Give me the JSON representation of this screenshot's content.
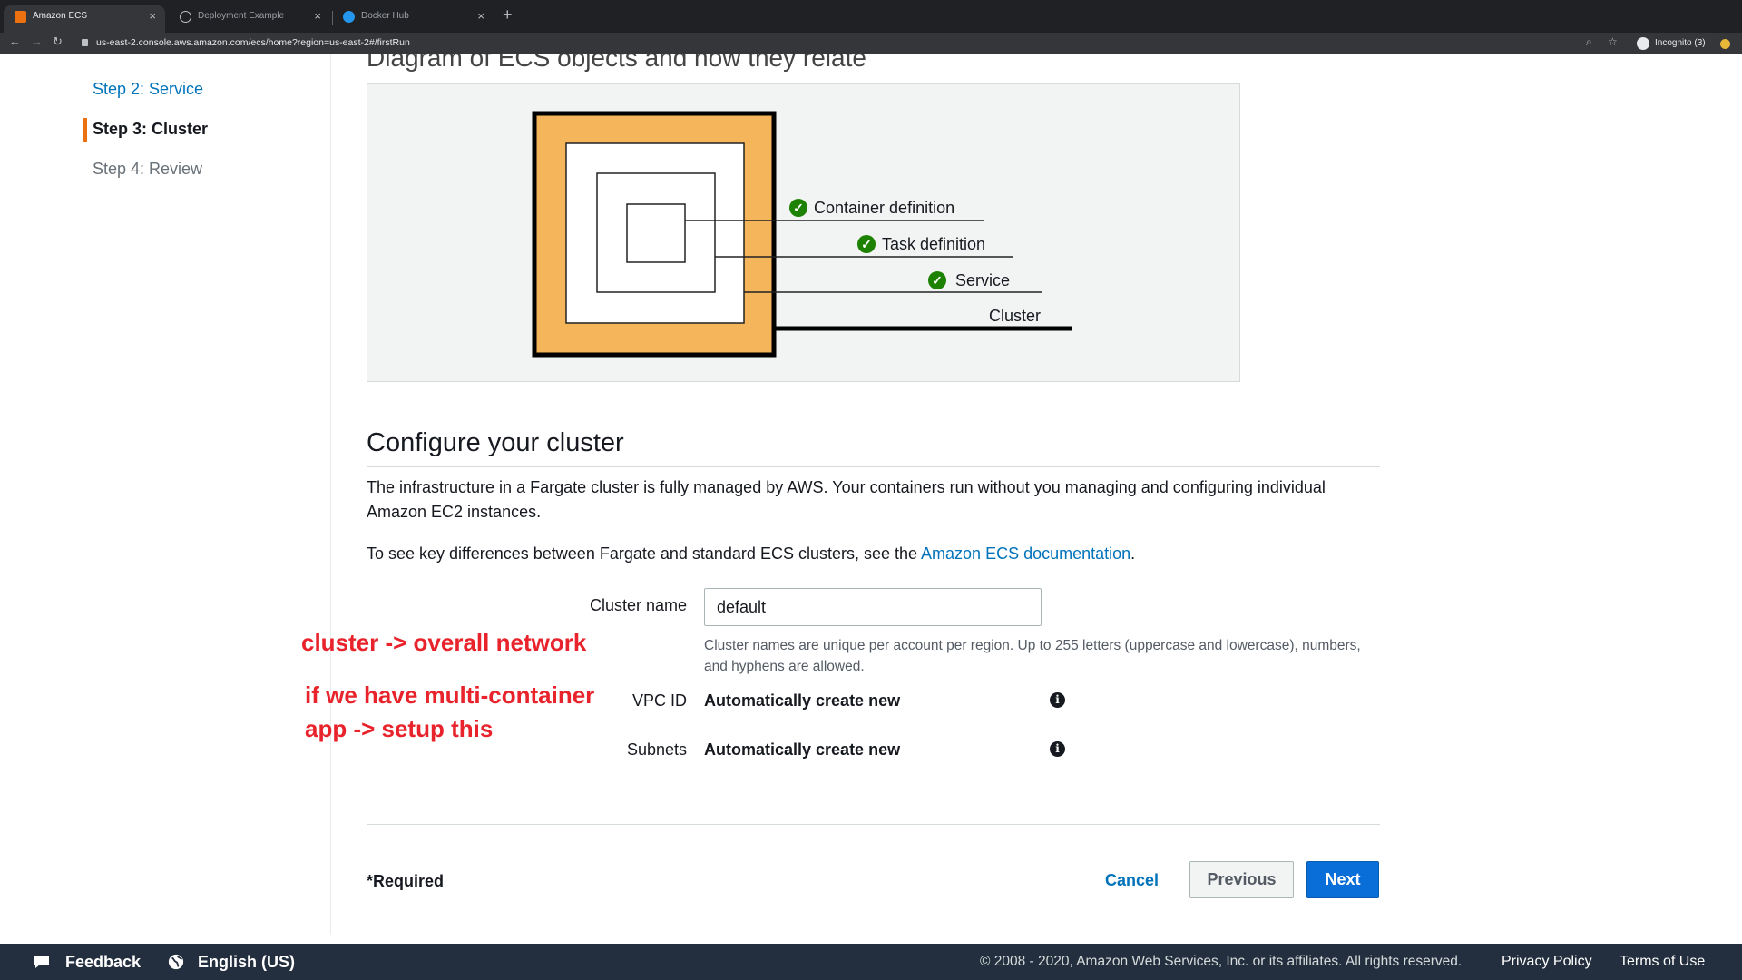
{
  "browser": {
    "tabs": [
      {
        "title": "Amazon ECS",
        "active": true
      },
      {
        "title": "Deployment Example",
        "active": false
      },
      {
        "title": "Docker Hub",
        "active": false
      }
    ],
    "url_host": "us-east-2.console.aws.amazon.com",
    "url_path": "/ecs/home?region=us-east-2#/firstRun",
    "incognito_label": "Incognito (3)"
  },
  "sidebar": {
    "steps": [
      {
        "label": "Step 2: Service",
        "state": "link"
      },
      {
        "label": "Step 3: Cluster",
        "state": "current"
      },
      {
        "label": "Step 4: Review",
        "state": "disabled"
      }
    ]
  },
  "diagram": {
    "title": "Diagram of ECS objects and how they relate",
    "labels": [
      {
        "text": "Container definition",
        "checked": true
      },
      {
        "text": "Task definition",
        "checked": true
      },
      {
        "text": "Service",
        "checked": true
      },
      {
        "text": "Cluster",
        "checked": false
      }
    ]
  },
  "configure": {
    "title": "Configure your cluster",
    "intro": "The infrastructure in a Fargate cluster is fully managed by AWS. Your containers run without you managing and configuring individual Amazon EC2 instances.",
    "docs_prefix": "To see key differences between Fargate and standard ECS clusters, see the ",
    "docs_link": "Amazon ECS documentation",
    "docs_suffix": ".",
    "cluster_name_label": "Cluster name",
    "cluster_name_value": "default",
    "cluster_name_hint": "Cluster names are unique per account per region. Up to 255 letters (uppercase and lowercase), numbers, and hyphens are allowed.",
    "vpc_label": "VPC ID",
    "vpc_value": "Automatically create new",
    "subnets_label": "Subnets",
    "subnets_value": "Automatically create new"
  },
  "annotations": {
    "line1": "cluster -> overall network",
    "line2": "if we have multi-container",
    "line3": "app -> setup this"
  },
  "actions": {
    "required": "*Required",
    "cancel": "Cancel",
    "previous": "Previous",
    "next": "Next"
  },
  "footer": {
    "feedback": "Feedback",
    "language": "English (US)",
    "copyright": "© 2008 - 2020, Amazon Web Services, Inc. or its affiliates. All rights reserved.",
    "privacy": "Privacy Policy",
    "terms": "Terms of Use"
  },
  "colors": {
    "accent_orange": "#ec7211",
    "link_blue": "#0073bb",
    "primary_button": "#0a6ed8",
    "diagram_orange": "#f5b55a",
    "check_green": "#1d8102",
    "annotation_red": "#e8232b",
    "footer_bg": "#232f3e"
  }
}
